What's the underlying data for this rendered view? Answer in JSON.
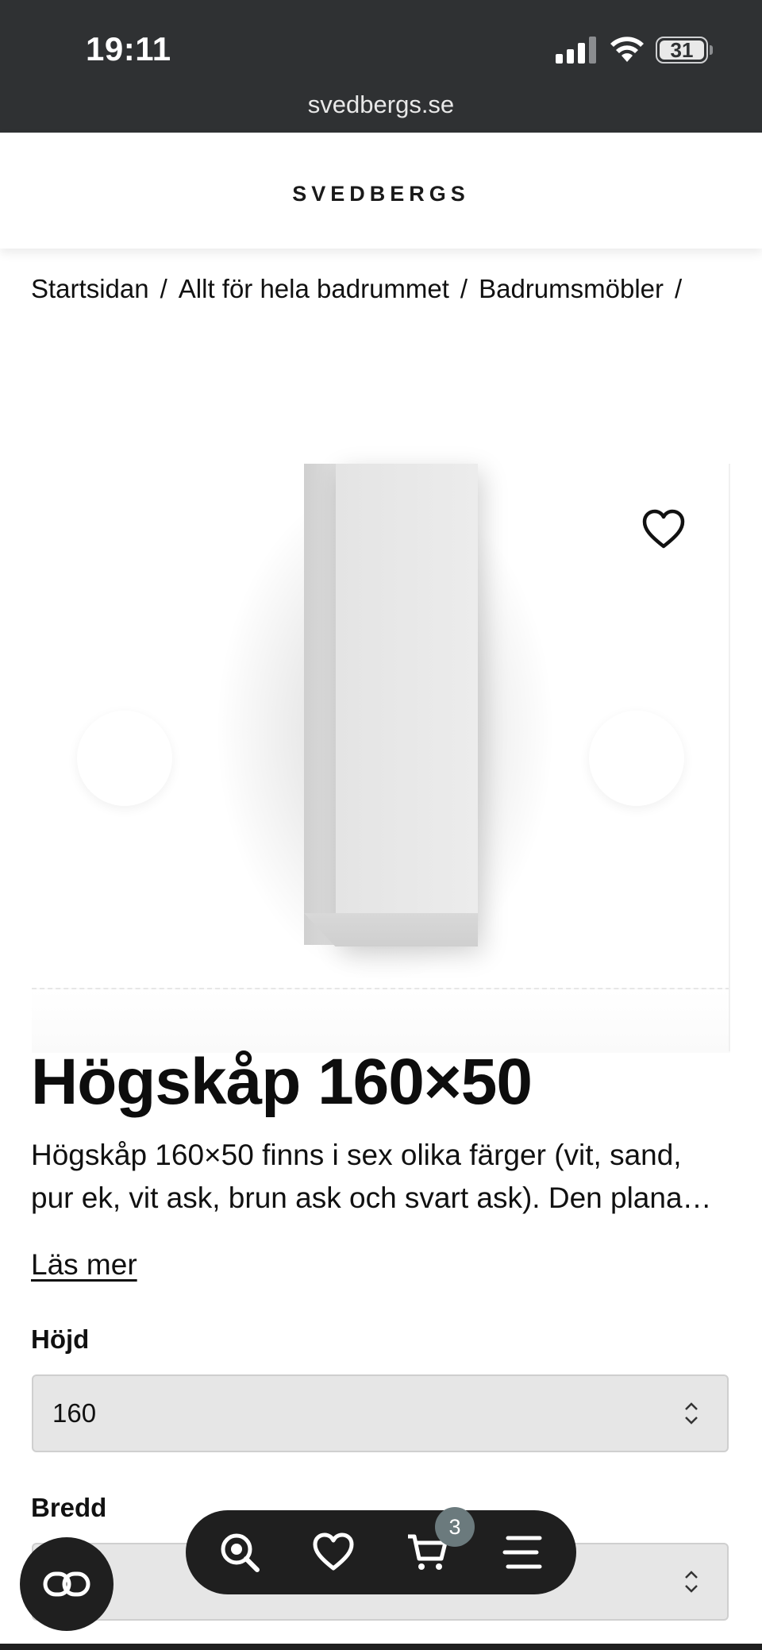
{
  "status": {
    "time": "19:11",
    "battery": "31",
    "url": "svedbergs.se"
  },
  "header": {
    "logo": "SVEDBERGS"
  },
  "breadcrumb": [
    "Startsidan",
    "Allt för hela badrummet",
    "Badrumsmöbler"
  ],
  "breadcrumb_separator": "/",
  "product": {
    "title": "Högskåp 160×50",
    "description": "Högskåp 160×50 finns i sex olika färger (vit, sand, pur ek, vit ask, brun ask och svart ask). Den plana lådfronten ger ett stilrent intryck.",
    "read_more": "Läs mer",
    "favorite_icon": "heart-outline-icon"
  },
  "options": {
    "height_label": "Höjd",
    "height_value": "160",
    "width_label": "Bredd",
    "width_value": ""
  },
  "bottom_nav": {
    "items": [
      "search-icon",
      "heart-icon",
      "cart-icon",
      "menu-icon"
    ],
    "cart_count": "3",
    "fab_icon": "chat-link-icon"
  },
  "colors": {
    "dark": "#1f1f1f",
    "statusbar": "#2f3133",
    "badge": "#6b7a7d",
    "select_bg": "#e6e6e6"
  }
}
